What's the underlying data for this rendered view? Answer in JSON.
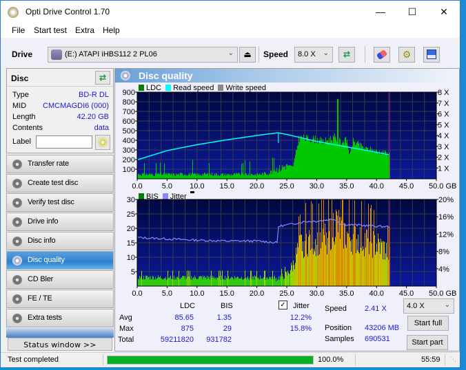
{
  "window": {
    "title": "Opti Drive Control 1.70",
    "controls": {
      "minimize": "—",
      "maximize": "☐",
      "close": "✕"
    }
  },
  "menu": [
    "File",
    "Start test",
    "Extra",
    "Help"
  ],
  "toolbar": {
    "drive_label": "Drive",
    "drive_value": "(E:)  ATAPI iHBS112  2 PL06",
    "speed_label": "Speed",
    "speed_value": "8.0 X",
    "icons": [
      "eject-icon",
      "refresh-icon",
      "eraser-icon",
      "gears-icon",
      "save-icon"
    ]
  },
  "disc": {
    "header": "Disc",
    "rows": [
      {
        "key": "Type",
        "value": "BD-R DL"
      },
      {
        "key": "MID",
        "value": "CMCMAGDI6 (000)"
      },
      {
        "key": "Length",
        "value": "42.20 GB"
      },
      {
        "key": "Contents",
        "value": "data"
      }
    ],
    "label_key": "Label",
    "label_value": ""
  },
  "nav": [
    {
      "label": "Transfer rate",
      "active": false
    },
    {
      "label": "Create test disc",
      "active": false
    },
    {
      "label": "Verify test disc",
      "active": false
    },
    {
      "label": "Drive info",
      "active": false
    },
    {
      "label": "Disc info",
      "active": false
    },
    {
      "label": "Disc quality",
      "active": true
    },
    {
      "label": "CD Bler",
      "active": false
    },
    {
      "label": "FE / TE",
      "active": false
    },
    {
      "label": "Extra tests",
      "active": false
    }
  ],
  "status_window_label": "Status window >>",
  "main": {
    "header": "Disc quality",
    "legend_top": [
      {
        "label": "LDC",
        "color": "#008000"
      },
      {
        "label": "Read speed",
        "color": "#00ffff"
      },
      {
        "label": "Write speed",
        "color": "#888888"
      }
    ],
    "legend_bottom": [
      {
        "label": "BIS",
        "color": "#008000"
      },
      {
        "label": "Jitter",
        "color": "#8888ff"
      }
    ]
  },
  "chart_data": [
    {
      "type": "area",
      "title": "LDC / Read speed",
      "xlabel": "GB",
      "xlim": [
        0,
        50
      ],
      "x_ticks": [
        "0.0",
        "5.0",
        "10.0",
        "15.0",
        "20.0",
        "25.0",
        "30.0",
        "35.0",
        "40.0",
        "45.0",
        "50.0 GB"
      ],
      "y_left_ticks": [
        "900",
        "800",
        "700",
        "600",
        "500",
        "400",
        "300",
        "200",
        "100"
      ],
      "ylim_left": [
        0,
        900
      ],
      "y_right_ticks": [
        "8 X",
        "7 X",
        "6 X",
        "5 X",
        "4 X",
        "3 X",
        "2 X",
        "1 X"
      ],
      "ylim_right": [
        0,
        8
      ],
      "grid": true,
      "end_marker_gb": 42.2,
      "series": [
        {
          "name": "LDC",
          "color": "#00c800",
          "x": [
            0,
            2,
            4,
            6,
            8,
            10,
            12,
            14,
            16,
            18,
            20,
            22,
            23,
            24,
            25,
            26,
            27,
            28,
            29,
            30,
            31,
            32,
            33,
            34,
            35,
            35.5,
            36,
            37,
            38,
            39,
            40,
            41,
            42.2
          ],
          "values": [
            50,
            45,
            50,
            45,
            50,
            45,
            50,
            45,
            45,
            50,
            45,
            60,
            100,
            110,
            150,
            130,
            450,
            440,
            440,
            430,
            400,
            430,
            450,
            400,
            420,
            250,
            410,
            370,
            330,
            320,
            300,
            290,
            270
          ]
        },
        {
          "name": "Read speed",
          "color": "#00ffff",
          "x": [
            0,
            5,
            10,
            15,
            20,
            23.5,
            25,
            30,
            35,
            40,
            42.2
          ],
          "values": [
            1.75,
            2.6,
            3.15,
            3.6,
            4.0,
            4.25,
            4.1,
            3.45,
            2.95,
            2.45,
            2.2
          ]
        }
      ]
    },
    {
      "type": "area",
      "title": "BIS / Jitter",
      "xlabel": "GB",
      "xlim": [
        0,
        50
      ],
      "x_ticks": [
        "0.0",
        "5.0",
        "10.0",
        "15.0",
        "20.0",
        "25.0",
        "30.0",
        "35.0",
        "40.0",
        "45.0",
        "50.0 GB"
      ],
      "y_left_ticks": [
        "30",
        "25",
        "20",
        "15",
        "10",
        "5"
      ],
      "ylim_left": [
        0,
        30
      ],
      "y_right_ticks": [
        "20%",
        "16%",
        "12%",
        "8%",
        "4%"
      ],
      "ylim_right": [
        0,
        20
      ],
      "grid": true,
      "end_marker_gb": 42.2,
      "series": [
        {
          "name": "BIS",
          "color": "#c8c800",
          "x": [
            0,
            5,
            10,
            15,
            20,
            23,
            24,
            25,
            26,
            27,
            28,
            30,
            32,
            33,
            34,
            35,
            36,
            38,
            40,
            42.2
          ],
          "values": [
            3,
            3,
            3,
            3,
            3,
            3,
            4,
            5,
            9,
            17,
            20,
            20,
            22,
            28,
            24,
            22,
            21,
            20,
            18,
            14
          ]
        },
        {
          "name": "Jitter",
          "color": "#8888ff",
          "x": [
            0,
            5,
            10,
            15,
            20,
            22,
            23.4,
            23.6,
            25,
            28,
            30,
            33,
            34,
            35,
            38,
            40,
            42.2
          ],
          "values": [
            11.2,
            10.9,
            10.6,
            10.4,
            10.4,
            10.2,
            10.0,
            13.8,
            14.1,
            14.9,
            15.0,
            15.5,
            14.4,
            14.2,
            14.0,
            13.8,
            13.7
          ]
        }
      ]
    }
  ],
  "stats": {
    "col_ldc": "LDC",
    "col_bis": "BIS",
    "jitter_label": "Jitter",
    "jitter_checked": true,
    "rows": [
      {
        "label": "Avg",
        "ldc": "85.65",
        "bis": "1.35",
        "jitter": "12.2%"
      },
      {
        "label": "Max",
        "ldc": "875",
        "bis": "29",
        "jitter": "15.8%"
      },
      {
        "label": "Total",
        "ldc": "59211820",
        "bis": "931782",
        "jitter": ""
      }
    ],
    "speed_label": "Speed",
    "speed_value": "2.41 X",
    "position_label": "Position",
    "position_value": "43206 MB",
    "samples_label": "Samples",
    "samples_value": "690531",
    "speed_select": "4.0 X",
    "start_full": "Start full",
    "start_part": "Start part"
  },
  "statusbar": {
    "text": "Test completed",
    "progress_percent": 100,
    "progress_label": "100.0%",
    "time": "55:59"
  }
}
